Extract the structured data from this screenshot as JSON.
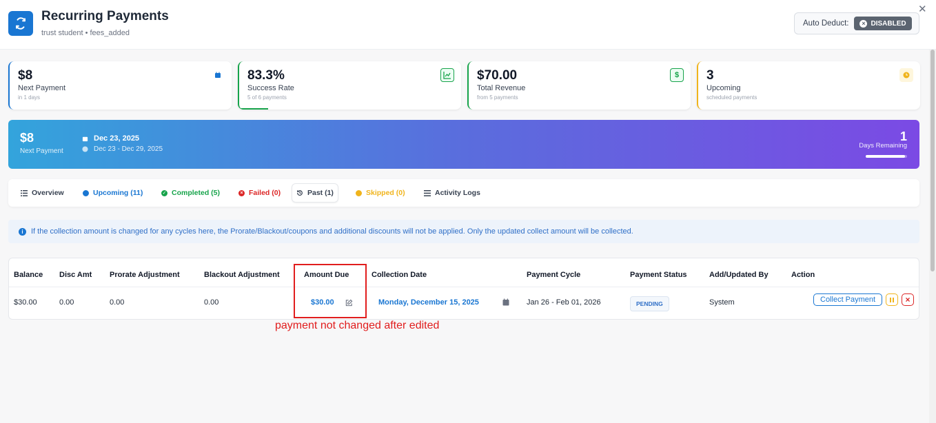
{
  "header": {
    "title": "Recurring Payments",
    "subtitle": "trust student • fees_added",
    "auto_deduct_label": "Auto Deduct:",
    "auto_deduct_status": "DISABLED"
  },
  "stats": [
    {
      "value": "$8",
      "label": "Next Payment",
      "sub": "in 1 days",
      "icon": "calendar-icon",
      "color": "#1976d2"
    },
    {
      "value": "83.3%",
      "label": "Success Rate",
      "sub": "5 of 6 payments",
      "icon": "chart-line-icon",
      "color": "#16a34a",
      "progress": 0.833
    },
    {
      "value": "$70.00",
      "label": "Total Revenue",
      "sub": "from 5 payments",
      "icon": "dollar-icon",
      "color": "#16a34a"
    },
    {
      "value": "3",
      "label": "Upcoming",
      "sub": "scheduled payments",
      "icon": "clock-icon",
      "color": "#f0b41c"
    }
  ],
  "banner": {
    "amount": "$8",
    "amount_label": "Next Payment",
    "date": "Dec 23, 2025",
    "date_range": "Dec 23 - Dec 29, 2025",
    "days": "1",
    "days_label": "Days Remaining",
    "days_progress": 0.95
  },
  "tabs": [
    {
      "label": "Overview",
      "icon": "list-icon",
      "color": "#374151"
    },
    {
      "label": "Upcoming (11)",
      "icon": "clock-icon",
      "color": "#1976d2"
    },
    {
      "label": "Completed (5)",
      "icon": "check-circle-icon",
      "color": "#16a34a"
    },
    {
      "label": "Failed (0)",
      "icon": "x-circle-icon",
      "color": "#dc2626"
    },
    {
      "label": "Past (1)",
      "icon": "history-icon",
      "color": "#374151",
      "active": true
    },
    {
      "label": "Skipped (0)",
      "icon": "skip-icon",
      "color": "#f0b41c"
    },
    {
      "label": "Activity Logs",
      "icon": "list-icon",
      "color": "#374151"
    }
  ],
  "info": {
    "text": "If the collection amount is changed for any cycles here, the Prorate/Blackout/coupons and additional discounts will not be applied. Only the updated collect amount will be collected."
  },
  "table": {
    "headers": [
      "Balance",
      "Disc Amt",
      "Prorate Adjustment",
      "Blackout Adjustment",
      "Amount Due",
      "Collection Date",
      "Payment Cycle",
      "Payment Status",
      "Add/Updated By",
      "Action"
    ],
    "row": {
      "balance": "$30.00",
      "disc": "0.00",
      "prorate": "0.00",
      "blackout": "0.00",
      "amount_due": "$30.00",
      "collection_date": "Monday, December 15, 2025",
      "cycle": "Jan 26 - Feb 01, 2026",
      "status": "PENDING",
      "updated_by": "System",
      "collect_label": "Collect Payment"
    }
  },
  "annotation": {
    "text": "payment not changed after edited",
    "color": "#e11d1d"
  }
}
